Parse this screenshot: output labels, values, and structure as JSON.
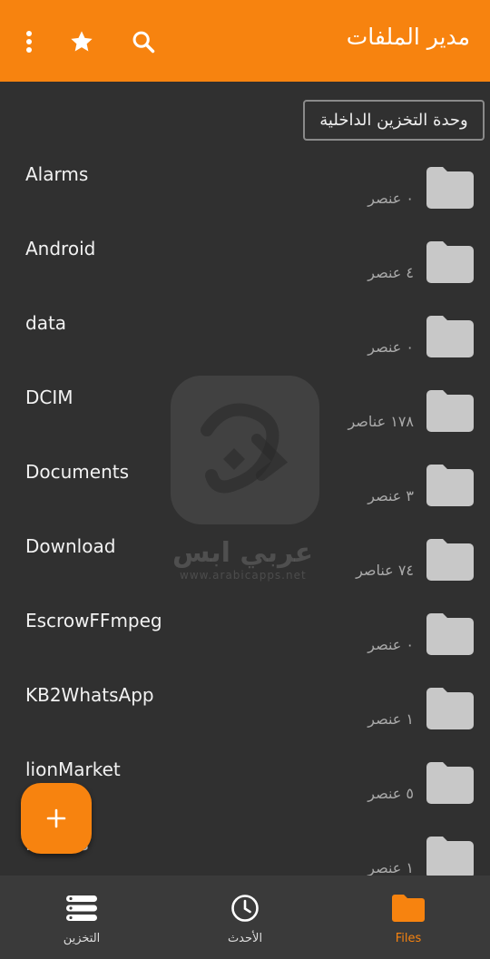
{
  "app_bar": {
    "title": "مدير الملفات",
    "icons": [
      "more-vert-icon",
      "star-icon",
      "search-icon"
    ],
    "color": "#f7830f"
  },
  "storage_chip": {
    "label": "وحدة التخزين الداخلية"
  },
  "files": [
    {
      "name": "Alarms",
      "count": "٠ عنصر"
    },
    {
      "name": "Android",
      "count": "٤ عنصر"
    },
    {
      "name": "data",
      "count": "٠ عنصر"
    },
    {
      "name": "DCIM",
      "count": "١٧٨ عناصر"
    },
    {
      "name": "Documents",
      "count": "٣ عنصر"
    },
    {
      "name": "Download",
      "count": "٧٤ عناصر"
    },
    {
      "name": "EscrowFFmpeg",
      "count": "٠ عنصر"
    },
    {
      "name": "KB2WhatsApp",
      "count": "١ عنصر"
    },
    {
      "name": "lionMarket",
      "count": "٥ عنصر"
    },
    {
      "name": "Movies",
      "count": "١ عنصر"
    }
  ],
  "watermark": {
    "text": "عربي ابس",
    "url": "www.arabicapps.net"
  },
  "fab": {
    "icon": "plus-icon"
  },
  "bottom_nav": {
    "items": [
      {
        "label": "التخزين",
        "icon": "storage-icon",
        "active": false
      },
      {
        "label": "الأحدث",
        "icon": "clock-icon",
        "active": false
      },
      {
        "label": "Files",
        "icon": "folder-icon",
        "active": true
      }
    ],
    "active_color": "#f7830f"
  }
}
